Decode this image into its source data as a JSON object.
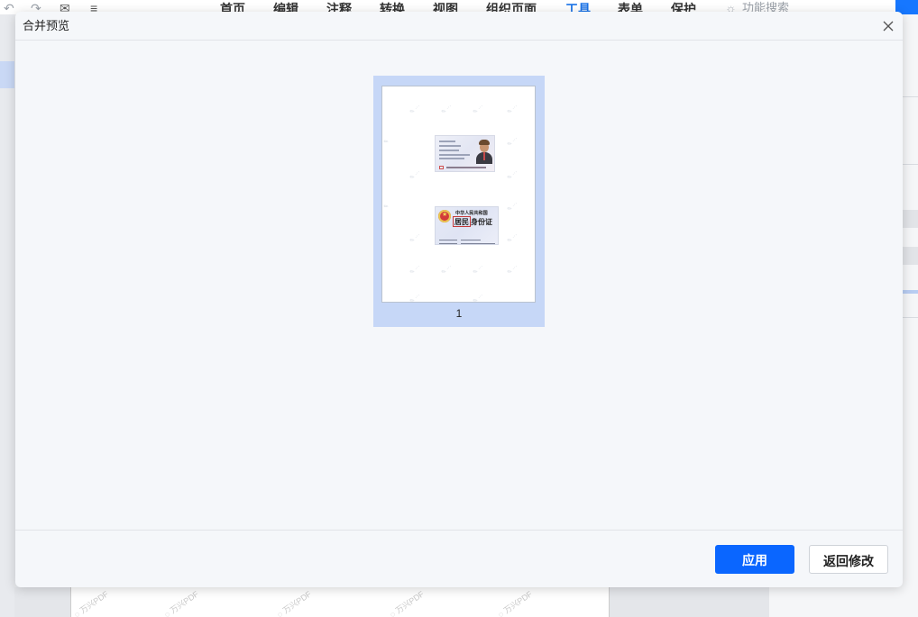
{
  "app": {
    "menu_tabs": [
      "首页",
      "编辑",
      "注释",
      "转换",
      "视图",
      "组织页面",
      "工具",
      "表单",
      "保护"
    ],
    "active_tab": "工具",
    "feature_search": "功能搜索"
  },
  "dialog": {
    "title": "合并预览",
    "pages": [
      {
        "number": "1",
        "front_card": {
          "type": "id-card-front"
        },
        "back_card": {
          "country_line": "中华人民共和国",
          "title_boxed": "居民",
          "title_rest": "身份证"
        }
      }
    ],
    "buttons": {
      "apply": "应用",
      "back": "返回修改"
    }
  },
  "colors": {
    "primary": "#0a66ff",
    "selection_bg": "#c6d7f7",
    "dialog_bg": "#f5f7fa"
  },
  "icons": {
    "close": "close-icon",
    "undo": "undo-icon",
    "redo": "redo-icon",
    "mail": "mail-icon",
    "menu": "menu-icon",
    "search": "lightbulb-icon"
  }
}
